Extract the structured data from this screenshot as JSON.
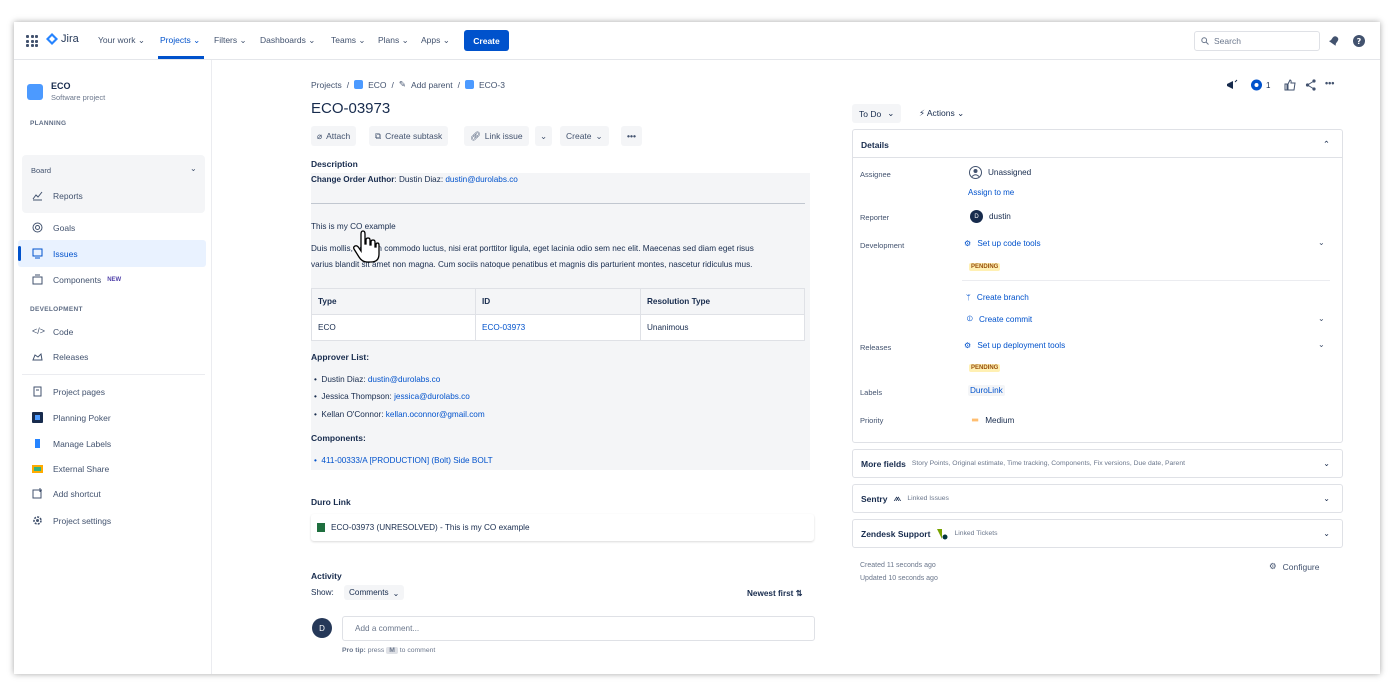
{
  "topnav": {
    "logo": "Jira",
    "items": [
      "Your work",
      "Projects",
      "Filters",
      "Dashboards",
      "Teams",
      "Plans",
      "Apps"
    ],
    "create_label": "Create",
    "search_placeholder": "Search"
  },
  "sidebar": {
    "project_name": "ECO",
    "project_type": "Software project",
    "planning_header": "PLANNING",
    "board_label": "Board",
    "reports": "Reports",
    "goals": "Goals",
    "issues": "Issues",
    "components": "Components",
    "new_badge": "NEW",
    "development_header": "DEVELOPMENT",
    "code": "Code",
    "releases": "Releases",
    "project_pages": "Project pages",
    "planning_poker": "Planning Poker",
    "manage_labels": "Manage Labels",
    "external_share": "External Share",
    "add_shortcut": "Add shortcut",
    "project_settings": "Project settings"
  },
  "breadcrumb": {
    "projects": "Projects",
    "eco": "ECO",
    "add_parent": "Add parent",
    "issue": "ECO-3"
  },
  "issue": {
    "key": "ECO-03973",
    "toolbar": {
      "attach": "Attach",
      "create_subtask": "Create subtask",
      "link_issue": "Link issue",
      "create": "Create"
    },
    "description_label": "Description",
    "author_label": "Change Order Author",
    "author_name": ": Dustin Diaz: ",
    "author_email": "dustin@durolabs.co",
    "co_example": "This is my CO example",
    "lorem_line1": "Duis mollis, est non commodo luctus, nisi erat porttitor ligula, eget lacinia odio sem nec elit. Maecenas sed diam eget risus",
    "lorem_line2": "varius blandit sit amet non magna. Cum sociis natoque penatibus et magnis dis parturient montes, nascetur ridiculus mus.",
    "table": {
      "headers": [
        "Type",
        "ID",
        "Resolution Type"
      ],
      "row": [
        "ECO",
        "ECO-03973",
        "Unanimous"
      ]
    },
    "approver_label": "Approver List:",
    "approvers": [
      {
        "name": "Dustin Diaz: ",
        "email": "dustin@durolabs.co"
      },
      {
        "name": "Jessica Thompson: ",
        "email": "jessica@durolabs.co"
      },
      {
        "name": "Kellan O'Connor: ",
        "email": "kellan.oconnor@gmail.com"
      }
    ],
    "components_label": "Components:",
    "component_item": "411-00333/A [PRODUCTION] (Bolt) Side BOLT",
    "duro_link_label": "Duro Link",
    "duro_link_text": "ECO-03973 (UNRESOLVED) - This is my CO example",
    "activity_label": "Activity",
    "show_label": "Show:",
    "show_value": "Comments",
    "sort_label": "Newest first",
    "avatar_initial": "D",
    "comment_placeholder": "Add a comment...",
    "pro_tip": "Pro tip:",
    "pro_tip_press": "press",
    "pro_tip_key": "M",
    "pro_tip_rest": "to comment"
  },
  "panel": {
    "status": "To Do",
    "actions": "Actions",
    "watch_count": "1",
    "details_title": "Details",
    "assignee_label": "Assignee",
    "assignee_value": "Unassigned",
    "assign_to_me": "Assign to me",
    "reporter_label": "Reporter",
    "reporter_value": "dustin",
    "development_label": "Development",
    "setup_code_tools": "Set up code tools",
    "pending": "PENDING",
    "create_branch": "Create branch",
    "create_commit": "Create commit",
    "releases_label": "Releases",
    "setup_deployment_tools": "Set up deployment tools",
    "labels_label": "Labels",
    "labels_value": "DuroLink",
    "priority_label": "Priority",
    "priority_value": "Medium",
    "more_fields": "More fields",
    "more_fields_sub": "Story Points, Original estimate, Time tracking, Components, Fix versions, Due date, Parent",
    "sentry": "Sentry",
    "sentry_sub": "Linked Issues",
    "zendesk": "Zendesk Support",
    "zendesk_sub": "Linked Tickets",
    "created": "Created 11 seconds ago",
    "updated": "Updated 10 seconds ago",
    "configure": "Configure"
  },
  "colors": {
    "brand": "#0052cc",
    "pending_bg": "#fff0b3",
    "pending_text": "#974f0c"
  }
}
